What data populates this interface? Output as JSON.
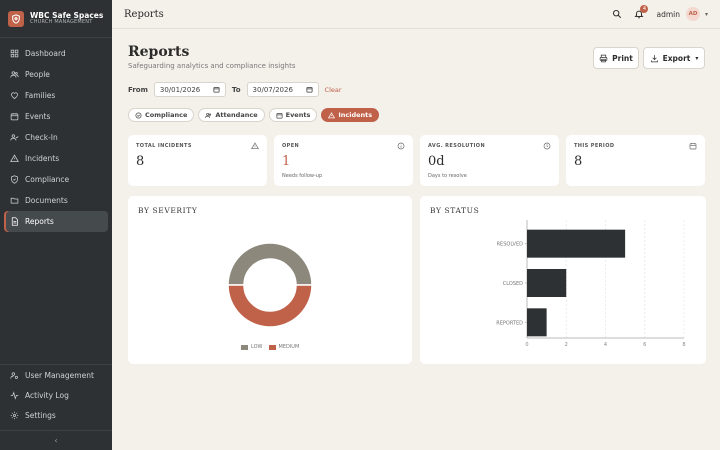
{
  "app": {
    "title": "WBC Safe Spaces",
    "subtitle": "CHURCH MANAGEMENT",
    "accent_color": "#c0614a"
  },
  "sidebar": {
    "items": [
      {
        "label": "Dashboard",
        "icon": "grid-icon"
      },
      {
        "label": "People",
        "icon": "people-icon"
      },
      {
        "label": "Families",
        "icon": "heart-icon"
      },
      {
        "label": "Events",
        "icon": "calendar-icon"
      },
      {
        "label": "Check-In",
        "icon": "check-in-icon"
      },
      {
        "label": "Incidents",
        "icon": "warning-icon"
      },
      {
        "label": "Compliance",
        "icon": "shield-icon"
      },
      {
        "label": "Documents",
        "icon": "folder-icon"
      },
      {
        "label": "Reports",
        "icon": "document-icon",
        "active": true
      }
    ],
    "bottom_items": [
      {
        "label": "User Management",
        "icon": "user-settings-icon"
      },
      {
        "label": "Activity Log",
        "icon": "activity-icon"
      },
      {
        "label": "Settings",
        "icon": "gear-icon"
      }
    ],
    "collapse_glyph": "‹"
  },
  "topbar": {
    "title": "Reports",
    "notification_count": "4",
    "user_name": "admin",
    "avatar_initials": "AD"
  },
  "page": {
    "title": "Reports",
    "subtitle": "Safeguarding analytics and compliance insights",
    "print_label": "Print",
    "export_label": "Export"
  },
  "filters": {
    "from_label": "From",
    "from_value": "30/01/2026",
    "to_label": "To",
    "to_value": "30/07/2026",
    "clear_label": "Clear"
  },
  "tabs": [
    {
      "label": "Compliance",
      "icon": "shield-icon",
      "active": false
    },
    {
      "label": "Attendance",
      "icon": "people-icon",
      "active": false
    },
    {
      "label": "Events",
      "icon": "calendar-icon",
      "active": false
    },
    {
      "label": "Incidents",
      "icon": "warning-icon",
      "active": true
    }
  ],
  "stats": [
    {
      "label": "TOTAL INCIDENTS",
      "value": "8",
      "note": "",
      "icon": "warning-icon"
    },
    {
      "label": "OPEN",
      "value": "1",
      "note": "Needs follow-up",
      "icon": "info-icon"
    },
    {
      "label": "AVG. RESOLUTION",
      "value": "0d",
      "note": "Days to resolve",
      "icon": "clock-icon"
    },
    {
      "label": "THIS PERIOD",
      "value": "8",
      "note": "",
      "icon": "calendar-icon"
    }
  ],
  "severity_panel": {
    "title": "BY SEVERITY",
    "legend": [
      {
        "label": "LOW",
        "color": "#8c887c"
      },
      {
        "label": "MEDIUM",
        "color": "#c0614a"
      }
    ]
  },
  "status_panel": {
    "title": "BY STATUS"
  },
  "chart_data": [
    {
      "type": "pie",
      "title": "BY SEVERITY",
      "donut": true,
      "categories": [
        "LOW",
        "MEDIUM"
      ],
      "values": [
        4,
        4
      ],
      "colors": [
        "#8c887c",
        "#c0614a"
      ],
      "legend": "bottom"
    },
    {
      "type": "bar",
      "orientation": "horizontal",
      "title": "BY STATUS",
      "categories": [
        "RESOLVED",
        "CLOSED",
        "REPORTED"
      ],
      "values": [
        5,
        2,
        1
      ],
      "color": "#2d3133",
      "xlim": [
        0,
        8
      ],
      "xticks": [
        0,
        2,
        4,
        6,
        8
      ],
      "grid": true
    }
  ]
}
